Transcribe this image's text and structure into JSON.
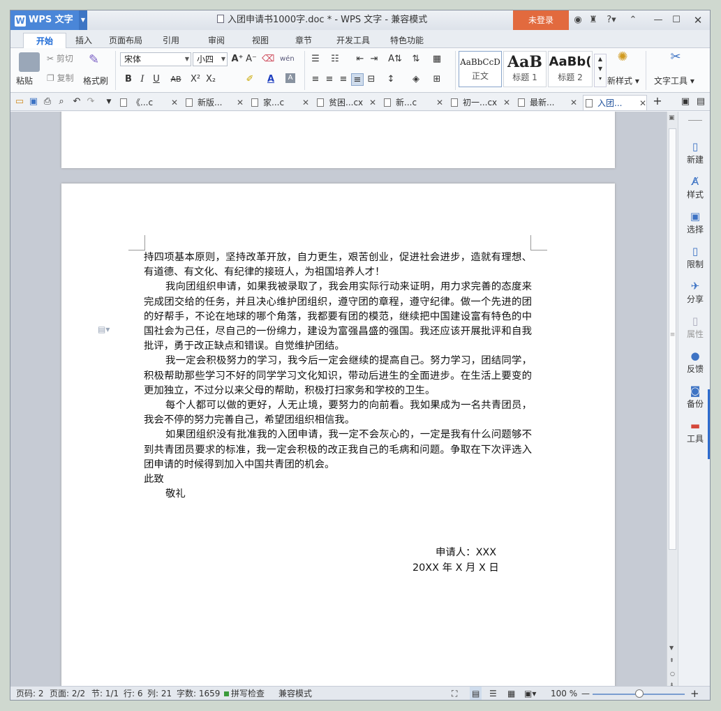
{
  "app": {
    "name": "WPS 文字",
    "window_title": "入团申请书1000字.doc * - WPS 文字 - 兼容模式",
    "login_label": "未登录"
  },
  "ribbon_tabs": [
    "开始",
    "插入",
    "页面布局",
    "引用",
    "审阅",
    "视图",
    "章节",
    "开发工具",
    "特色功能"
  ],
  "ribbon": {
    "paste": "粘贴",
    "cut": "剪切",
    "copy": "复制",
    "format_painter": "格式刷",
    "font_name": "宋体",
    "font_size": "小四",
    "styles": [
      {
        "preview": "AaBbCcD",
        "label": "正文"
      },
      {
        "preview": "AaB",
        "label": "标题 1"
      },
      {
        "preview": "AaBb(",
        "label": "标题 2"
      }
    ],
    "new_style": "新样式",
    "text_tools": "文字工具"
  },
  "doc_tabs": [
    "《...c",
    "新版...",
    "家...c",
    "贫困...cx",
    "新...c",
    "初一...cx",
    "最新...",
    "入团..."
  ],
  "document": {
    "paragraphs": [
      "持四项基本原则，坚持改革开放，自力更生，艰苦创业，促进社会进步，造就有理想、有道德、有文化、有纪律的接班人，为祖国培养人才！",
      "我向团组织申请，如果我被录取了，我会用实际行动来证明，用力求完善的态度来完成团交给的任务，并且决心维护团组织，遵守团的章程，遵守纪律。做一个先进的团的好帮手，不论在地球的哪个角落，我都要有团的模范，继续把中国建设富有特色的中国社会为己任，尽自己的一份绵力，建设为富强昌盛的强国。我还应该开展批评和自我批评，勇于改正缺点和错误。自觉维护团结。",
      "我一定会积极努力的学习，我今后一定会继续的提高自己。努力学习，团结同学，积极帮助那些学习不好的同学学习文化知识，带动后进生的全面进步。在生活上要变的更加独立，不过分以来父母的帮助，积极打扫家务和学校的卫生。",
      "每个人都可以做的更好，人无止境，要努力的向前看。我如果成为一名共青团员，我会不停的努力完善自己，希望团组织相信我。",
      "如果团组织没有批准我的入团申请，我一定不会灰心的，一定是我有什么问题够不到共青团员要求的标准，我一定会积极的改正我自己的毛病和问题。争取在下次评选入团申请的时候得到加入中国共青团的机会。"
    ],
    "closing": "此致",
    "salute": "敬礼",
    "applicant": "申请人：XXX",
    "date": "20XX 年 X 月 X 日"
  },
  "right_panel": [
    "新建",
    "样式",
    "选择",
    "限制",
    "分享",
    "属性",
    "反馈",
    "备份",
    "工具"
  ],
  "status": {
    "page_no": "页码: 2",
    "pages": "页面: 2/2",
    "section": "节: 1/1",
    "row": "行: 6",
    "col": "列: 21",
    "words": "字数: 1659",
    "spell": "拼写检查",
    "mode": "兼容模式",
    "zoom": "100 %"
  },
  "colors": {
    "accent": "#4a86d8",
    "login": "#e26a3e"
  }
}
